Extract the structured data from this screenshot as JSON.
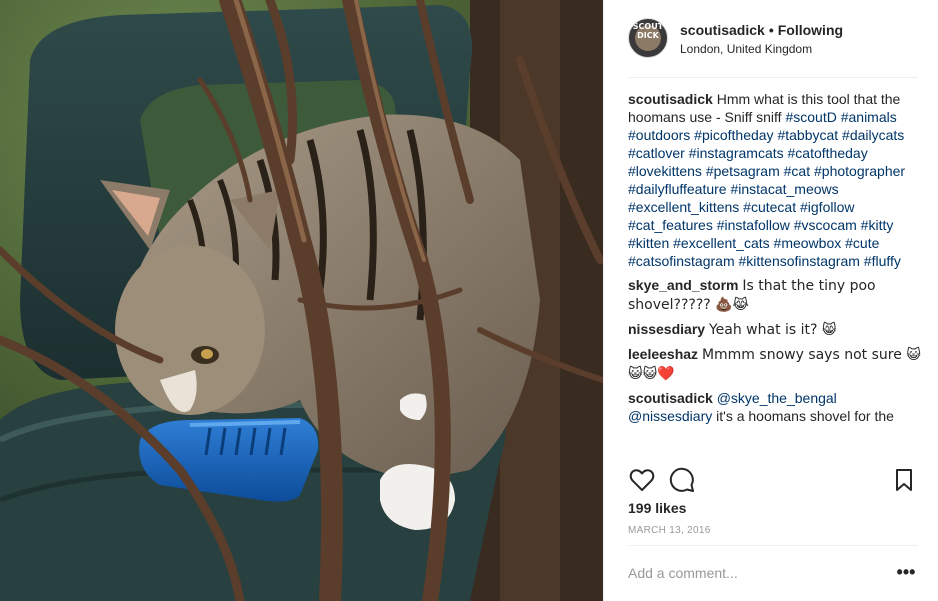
{
  "header": {
    "avatar_text": "SCOUT\nDICK",
    "username": "scoutisadick",
    "separator": "•",
    "follow_label": "Following",
    "location": "London, United Kingdom"
  },
  "comments": [
    {
      "user": "scoutisadick",
      "text": "Hmm what is this tool that the hoomans use - Sniff sniff ",
      "tags": "#scoutD #animals #outdoors #picoftheday #tabbycat #dailycats #catlover #instagramcats #catoftheday #lovekittens #petsagram #cat #photographer #dailyfluffeature #instacat_meows #excellent_kittens #cutecat #igfollow #cat_features #instafollow #vscocam #kitty #kitten #excellent_cats #meowbox #cute #catsofinstagram #kittensofinstagram #fluffy"
    },
    {
      "user": "skye_and_storm",
      "text": "Is that the tiny poo shovel????? 💩😹"
    },
    {
      "user": "nissesdiary",
      "text": "Yeah what is it? 😸"
    },
    {
      "user": "leeleeshaz",
      "text": "Mmmm snowy says not sure 😺😺😺❤️"
    },
    {
      "user": "scoutisadick",
      "tags": "@skye_the_bengal @nissesdiary",
      "text": " it's a hoomans shovel for the"
    }
  ],
  "actions": {
    "like_icon": "heart-icon",
    "comment_icon": "comment-bubble-icon",
    "save_icon": "bookmark-icon"
  },
  "likes": "199 likes",
  "date": "MARCH 13, 2016",
  "add_comment": {
    "placeholder": "Add a comment...",
    "more_label": "•••"
  },
  "colors": {
    "link": "#003569",
    "text": "#262626",
    "muted": "#999999",
    "divider": "#efefef"
  }
}
